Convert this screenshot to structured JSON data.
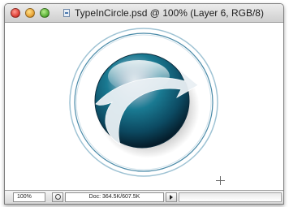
{
  "window": {
    "title": "TypeInCircle.psd @ 100% (Layer 6, RGB/8)"
  },
  "icons": {
    "close": "close-window-icon",
    "minimize": "minimize-window-icon",
    "zoom": "zoom-window-icon",
    "document": "document-icon",
    "navigator": "navigator-icon",
    "menu_arrow": "triangle-right-icon",
    "cursor": "crosshair-cursor-icon"
  },
  "status": {
    "zoom": "100%",
    "doc_info": "Doc: 364.5K/607.5K"
  },
  "colors": {
    "logo_teal": "#166f86",
    "logo_dark": "#0a3348",
    "ring": "#4a8aa8",
    "swoosh": "#e9f0f4"
  }
}
